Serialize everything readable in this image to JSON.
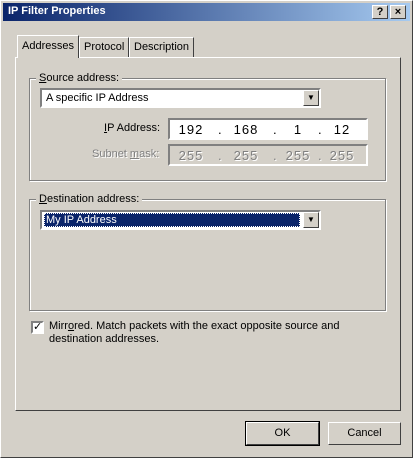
{
  "window": {
    "title": "IP Filter Properties",
    "help_glyph": "?",
    "close_glyph": "×"
  },
  "tabs": [
    {
      "label": "Addresses",
      "active": true
    },
    {
      "label": "Protocol",
      "active": false
    },
    {
      "label": "Description",
      "active": false
    }
  ],
  "source": {
    "group_label_prefix": "",
    "group_label_accel": "S",
    "group_label_rest": "ource address:",
    "selected": "A specific IP Address",
    "ip_label_prefix": "",
    "ip_label_accel": "I",
    "ip_label_rest": "P Address:",
    "ip": [
      "192",
      "168",
      "1",
      "12"
    ],
    "mask_label_prefix": "Subnet ",
    "mask_label_accel": "m",
    "mask_label_rest": "ask:",
    "mask": [
      "255",
      "255",
      "255",
      "255"
    ]
  },
  "destination": {
    "group_label_prefix": "",
    "group_label_accel": "D",
    "group_label_rest": "estination address:",
    "selected": "My IP Address"
  },
  "mirrored": {
    "checked": true,
    "check_glyph": "✓",
    "label_prefix": "Mirr",
    "label_accel": "o",
    "label_rest": "red. Match packets with the exact opposite source and destination addresses."
  },
  "buttons": {
    "ok": "OK",
    "cancel": "Cancel"
  },
  "colors": {
    "face": "#d4d0c8",
    "title_start": "#0a246a",
    "title_end": "#a6caf0",
    "selection": "#0a246a"
  }
}
